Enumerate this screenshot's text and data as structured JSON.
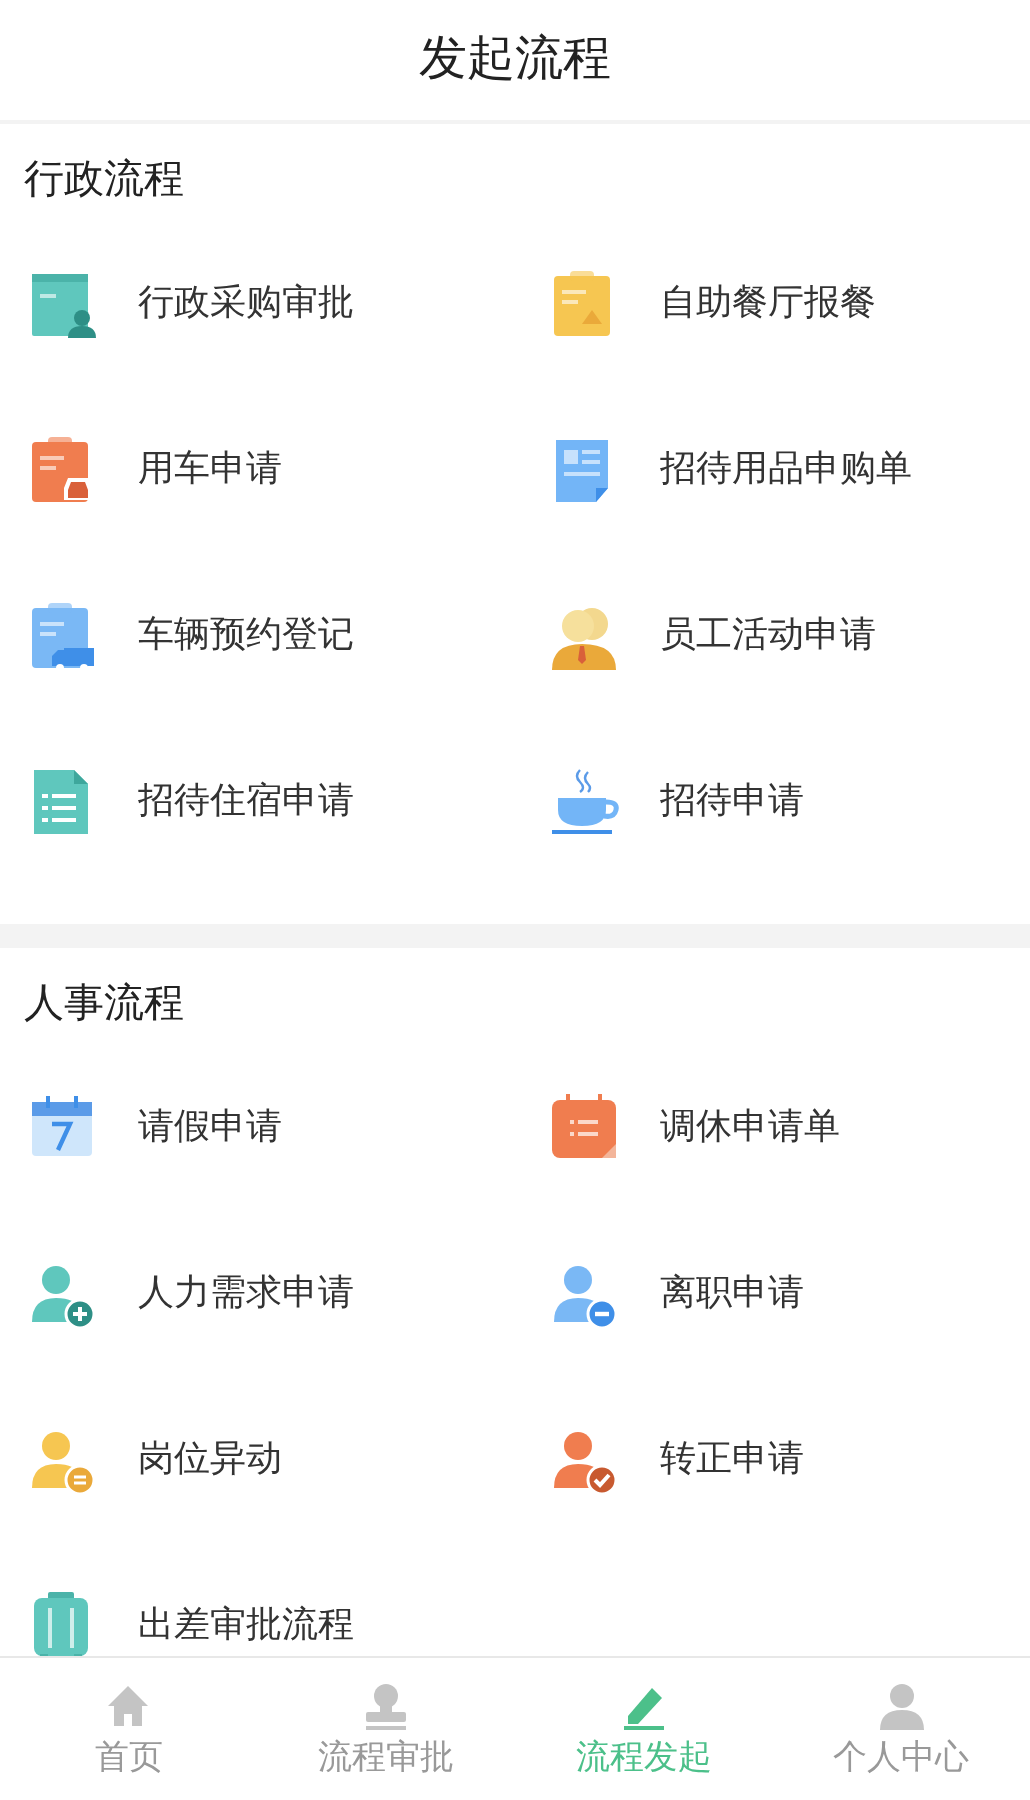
{
  "header": {
    "title": "发起流程"
  },
  "sections": [
    {
      "title": "行政流程",
      "items": [
        {
          "label": "行政采购审批",
          "kind": "calendar-person"
        },
        {
          "label": "自助餐厅报餐",
          "kind": "clipboard-food"
        },
        {
          "label": "用车申请",
          "kind": "clipboard-car"
        },
        {
          "label": "招待用品申购单",
          "kind": "document"
        },
        {
          "label": "车辆预约登记",
          "kind": "clipboard-truck"
        },
        {
          "label": "员工活动申请",
          "kind": "group"
        },
        {
          "label": "招待住宿申请",
          "kind": "list-file"
        },
        {
          "label": "招待申请",
          "kind": "cup"
        }
      ]
    },
    {
      "title": "人事流程",
      "items": [
        {
          "label": "请假申请",
          "kind": "calendar-day"
        },
        {
          "label": "调休申请单",
          "kind": "calendar-list"
        },
        {
          "label": "人力需求申请",
          "kind": "person-add"
        },
        {
          "label": "离职申请",
          "kind": "person-remove"
        },
        {
          "label": "岗位异动",
          "kind": "person-change"
        },
        {
          "label": "转正申请",
          "kind": "person-check"
        },
        {
          "label": "出差审批流程",
          "kind": "suitcase"
        }
      ]
    }
  ],
  "tabs": [
    {
      "label": "首页",
      "kind": "home",
      "selected": false
    },
    {
      "label": "流程审批",
      "kind": "stamp",
      "selected": false
    },
    {
      "label": "流程发起",
      "kind": "pen",
      "selected": true
    },
    {
      "label": "个人中心",
      "kind": "user",
      "selected": false
    }
  ]
}
